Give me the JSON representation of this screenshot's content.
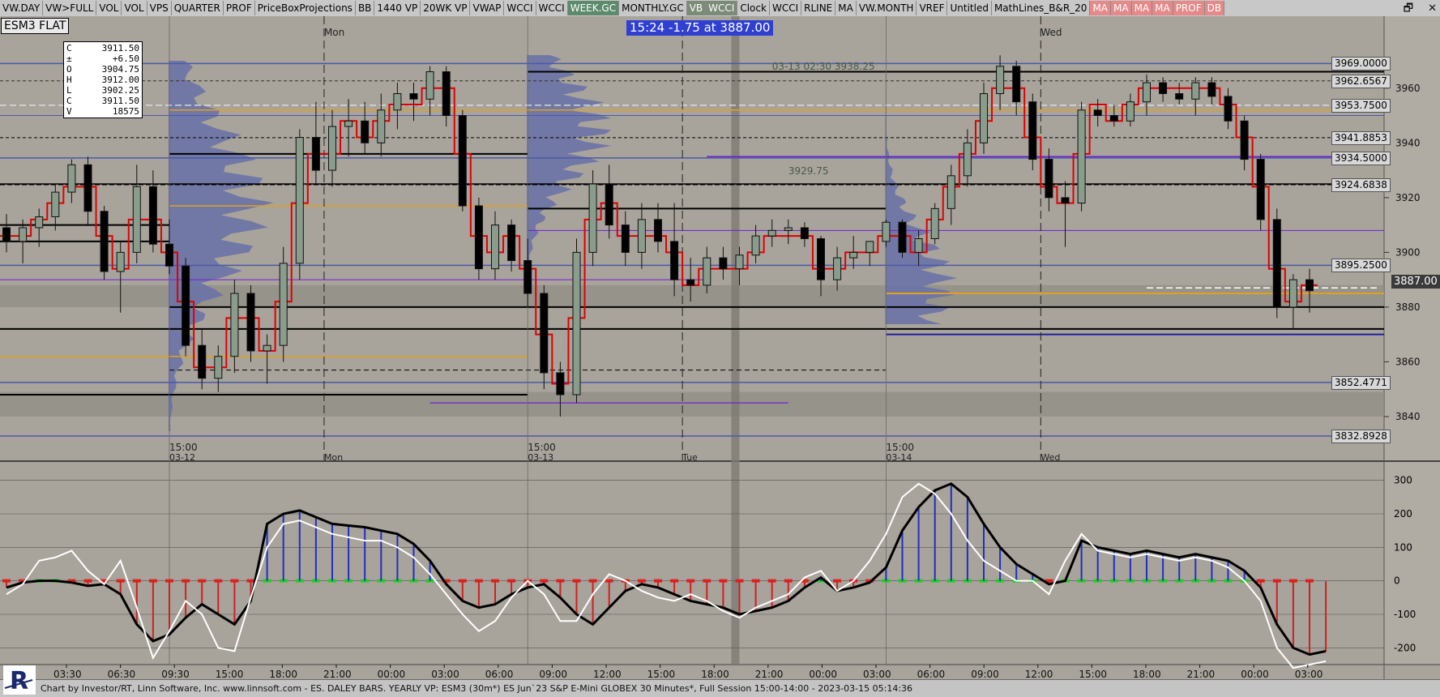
{
  "toolbar": {
    "buttons": [
      {
        "label": "VW.DAY",
        "style": "plain"
      },
      {
        "label": "VW>FULL",
        "style": "plain"
      },
      {
        "label": "VOL",
        "style": "plain"
      },
      {
        "label": "VOL",
        "style": "plain"
      },
      {
        "label": "VPS",
        "style": "plain"
      },
      {
        "label": "QUARTER",
        "style": "plain"
      },
      {
        "label": "PROF",
        "style": "plain"
      },
      {
        "label": "PriceBoxProjections",
        "style": "plain"
      },
      {
        "label": "BB",
        "style": "plain"
      },
      {
        "label": "1440 VP",
        "style": "plain"
      },
      {
        "label": "20WK VP",
        "style": "plain"
      },
      {
        "label": "VWAP",
        "style": "plain"
      },
      {
        "label": "WCCI",
        "style": "plain"
      },
      {
        "label": "WCCI",
        "style": "plain"
      },
      {
        "label": "WEEK.GC",
        "style": "green"
      },
      {
        "label": "MONTHLY.GC",
        "style": "plain"
      },
      {
        "label": "VB",
        "style": "dark"
      },
      {
        "label": "WCCI",
        "style": "dark"
      },
      {
        "label": "Clock",
        "style": "plain"
      },
      {
        "label": "WCCI",
        "style": "plain"
      },
      {
        "label": "RLINE",
        "style": "plain"
      },
      {
        "label": "MA",
        "style": "plain"
      },
      {
        "label": "VW.MONTH",
        "style": "plain"
      },
      {
        "label": "VREF",
        "style": "plain"
      },
      {
        "label": "Untitled",
        "style": "plain"
      },
      {
        "label": "MathLines_B&R_20",
        "style": "plain"
      },
      {
        "label": "MA",
        "style": "red"
      },
      {
        "label": "MA",
        "style": "red"
      },
      {
        "label": "MA",
        "style": "red"
      },
      {
        "label": "MA",
        "style": "red"
      },
      {
        "label": "PROF",
        "style": "red"
      },
      {
        "label": "DB",
        "style": "red"
      }
    ]
  },
  "symbol": "ESM3 FLAT",
  "banner": "15:24  -1.75 at 3887.00",
  "ohlc": [
    {
      "k": "C",
      "v": "3911.50"
    },
    {
      "k": "±",
      "v": "+6.50"
    },
    {
      "k": "O",
      "v": "3904.75"
    },
    {
      "k": "H",
      "v": "3912.00"
    },
    {
      "k": "L",
      "v": "3902.25"
    },
    {
      "k": "C",
      "v": "3911.50"
    },
    {
      "k": "V",
      "v": "18575"
    }
  ],
  "current_price": "3887.00",
  "level_labels": [
    {
      "text": "3969.0000",
      "price": 3969
    },
    {
      "text": "3962.6567",
      "price": 3962.66
    },
    {
      "text": "3953.7500",
      "price": 3953.75
    },
    {
      "text": "3941.8853",
      "price": 3941.89
    },
    {
      "text": "3934.5000",
      "price": 3934.5
    },
    {
      "text": "3924.6838",
      "price": 3924.68
    },
    {
      "text": "3895.2500",
      "price": 3895.25
    },
    {
      "text": "3852.4771",
      "price": 3852.48
    },
    {
      "text": "3832.8928",
      "price": 3832.89
    }
  ],
  "chart_annotations": [
    {
      "text": "3929.75",
      "price": 3929.75,
      "bar": 49
    },
    {
      "text": "03-13 02:30 3938.25",
      "price": 3968,
      "bar": 48
    }
  ],
  "day_labels": [
    {
      "text": "Mon",
      "bar": 19.5
    },
    {
      "text": "Tue",
      "bar": 41.5
    },
    {
      "text": "Wed",
      "bar": 63.5
    }
  ],
  "time_ticks_main": [
    {
      "top": "15:00",
      "bottom": "03-12",
      "bar": 10
    },
    {
      "top": "",
      "bottom": "Mon",
      "bar": 19.5
    },
    {
      "top": "15:00",
      "bottom": "03-13",
      "bar": 32
    },
    {
      "top": "",
      "bottom": "Tue",
      "bar": 41.5
    },
    {
      "top": "15:00",
      "bottom": "03-14",
      "bar": 54
    },
    {
      "top": "",
      "bottom": "Wed",
      "bar": 63.5
    }
  ],
  "time_ticks_bottom": [
    "03:30",
    "06:30",
    "09:30",
    "15:00",
    "18:00",
    "21:00",
    "00:00",
    "03:00",
    "06:00",
    "09:00",
    "12:00",
    "15:00",
    "18:00",
    "21:00",
    "00:00",
    "03:00",
    "06:00",
    "09:00",
    "12:00",
    "15:00",
    "18:00",
    "21:00",
    "00:00",
    "03:00"
  ],
  "footnote": "Chart by Investor/RT, Linn Software, Inc. www.linnsoft.com - ES. DALEY BARS. YEARLY VP: ESM3 (30m*) ES Jun`23 S&P E-Mini GLOBEX 30 Minutes*, Full Session 15:00-14:00 - 2023-03-15 05:14:36",
  "colors": {
    "bg": "#a8a39b",
    "bull": "#8a9c8c",
    "bear": "#000000",
    "vp": "#6b73a6",
    "red_line": "#e00000",
    "orange_line": "#e0a020",
    "purple_line": "#7020d0",
    "blue_line": "#4a5aa8"
  },
  "chart_data": [
    {
      "type": "candlestick",
      "title": "ESM3 FLAT",
      "ylabel": "",
      "ylim": [
        3824,
        3978
      ],
      "y_ticks": [
        3840,
        3860,
        3880,
        3900,
        3920,
        3940,
        3960
      ],
      "ohlc": [
        [
          3909,
          3914,
          3900,
          3904
        ],
        [
          3904,
          3912,
          3896,
          3909
        ],
        [
          3909,
          3916,
          3902,
          3913
        ],
        [
          3913,
          3925,
          3908,
          3922
        ],
        [
          3922,
          3934,
          3918,
          3932
        ],
        [
          3932,
          3935,
          3910,
          3915
        ],
        [
          3915,
          3917,
          3890,
          3893
        ],
        [
          3893,
          3904,
          3878,
          3900
        ],
        [
          3900,
          3932,
          3896,
          3924
        ],
        [
          3924,
          3930,
          3900,
          3903
        ],
        [
          3903,
          3912,
          3892,
          3895
        ],
        [
          3895,
          3898,
          3862,
          3866
        ],
        [
          3866,
          3872,
          3850,
          3854
        ],
        [
          3854,
          3866,
          3849,
          3862
        ],
        [
          3862,
          3890,
          3856,
          3885
        ],
        [
          3885,
          3888,
          3860,
          3864
        ],
        [
          3864,
          3870,
          3852,
          3866
        ],
        [
          3866,
          3902,
          3860,
          3896
        ],
        [
          3896,
          3945,
          3890,
          3942
        ],
        [
          3942,
          3955,
          3925,
          3930
        ],
        [
          3930,
          3952,
          3924,
          3946
        ],
        [
          3946,
          3956,
          3935,
          3948
        ],
        [
          3948,
          3955,
          3936,
          3940
        ],
        [
          3940,
          3958,
          3935,
          3952
        ],
        [
          3952,
          3962,
          3945,
          3958
        ],
        [
          3958,
          3962,
          3948,
          3956
        ],
        [
          3956,
          3968,
          3950,
          3966
        ],
        [
          3966,
          3968,
          3946,
          3950
        ],
        [
          3950,
          3952,
          3915,
          3917
        ],
        [
          3917,
          3920,
          3890,
          3894
        ],
        [
          3894,
          3915,
          3890,
          3910
        ],
        [
          3910,
          3912,
          3893,
          3897
        ],
        [
          3897,
          3905,
          3880,
          3885
        ],
        [
          3885,
          3888,
          3850,
          3856
        ],
        [
          3856,
          3860,
          3840,
          3848
        ],
        [
          3848,
          3905,
          3845,
          3900
        ],
        [
          3900,
          3930,
          3895,
          3925
        ],
        [
          3925,
          3932,
          3905,
          3910
        ],
        [
          3910,
          3915,
          3895,
          3900
        ],
        [
          3900,
          3918,
          3894,
          3912
        ],
        [
          3912,
          3918,
          3900,
          3904
        ],
        [
          3904,
          3918,
          3884,
          3890
        ],
        [
          3890,
          3898,
          3882,
          3888
        ],
        [
          3888,
          3902,
          3885,
          3898
        ],
        [
          3898,
          3902,
          3890,
          3894
        ],
        [
          3894,
          3902,
          3888,
          3899
        ],
        [
          3899,
          3910,
          3896,
          3906
        ],
        [
          3906,
          3912,
          3902,
          3908
        ],
        [
          3908,
          3912,
          3903,
          3909
        ],
        [
          3909,
          3911,
          3902,
          3905
        ],
        [
          3905,
          3906,
          3884,
          3890
        ],
        [
          3890,
          3902,
          3886,
          3898
        ],
        [
          3898,
          3906,
          3894,
          3900
        ],
        [
          3900,
          3904,
          3895,
          3904
        ],
        [
          3904,
          3912,
          3902,
          3911
        ],
        [
          3911,
          3912,
          3898,
          3900
        ],
        [
          3900,
          3908,
          3895,
          3905
        ],
        [
          3905,
          3918,
          3903,
          3916
        ],
        [
          3916,
          3932,
          3910,
          3928
        ],
        [
          3928,
          3945,
          3924,
          3940
        ],
        [
          3940,
          3962,
          3936,
          3958
        ],
        [
          3958,
          3972,
          3952,
          3968
        ],
        [
          3968,
          3970,
          3950,
          3955
        ],
        [
          3955,
          3958,
          3930,
          3934
        ],
        [
          3934,
          3938,
          3915,
          3920
        ],
        [
          3920,
          3926,
          3902,
          3918
        ],
        [
          3918,
          3955,
          3915,
          3952
        ],
        [
          3952,
          3956,
          3946,
          3950
        ],
        [
          3950,
          3954,
          3946,
          3948
        ],
        [
          3948,
          3958,
          3946,
          3955
        ],
        [
          3955,
          3965,
          3950,
          3962
        ],
        [
          3962,
          3964,
          3955,
          3958
        ],
        [
          3958,
          3962,
          3954,
          3956
        ],
        [
          3956,
          3964,
          3950,
          3962
        ],
        [
          3962,
          3964,
          3954,
          3957
        ],
        [
          3957,
          3960,
          3945,
          3948
        ],
        [
          3948,
          3950,
          3930,
          3934
        ],
        [
          3934,
          3936,
          3908,
          3912
        ],
        [
          3912,
          3916,
          3876,
          3880
        ],
        [
          3880,
          3892,
          3872,
          3890
        ],
        [
          3890,
          3894,
          3878,
          3886
        ]
      ]
    },
    {
      "type": "line",
      "title": "",
      "ylim": [
        -250,
        350
      ],
      "y_ticks": [
        -200,
        -100,
        0,
        100,
        200,
        300
      ],
      "series": [
        {
          "values": [
            -20,
            -5,
            0,
            0,
            -5,
            -15,
            -10,
            -40,
            -130,
            -180,
            -160,
            -110,
            -70,
            -100,
            -130,
            -60,
            170,
            200,
            210,
            190,
            170,
            165,
            160,
            150,
            140,
            110,
            60,
            -10,
            -60,
            -80,
            -70,
            -40,
            -20,
            -10,
            -50,
            -100,
            -130,
            -80,
            -30,
            -10,
            -20,
            -40,
            -60,
            -70,
            -80,
            -100,
            -90,
            -80,
            -60,
            -20,
            10,
            -30,
            -20,
            -5,
            40,
            150,
            220,
            270,
            290,
            250,
            170,
            100,
            50,
            20,
            -10,
            0,
            120,
            100,
            90,
            80,
            90,
            80,
            70,
            80,
            70,
            60,
            30,
            -20,
            -130,
            -200,
            -220,
            -210
          ],
          "color": "#000000"
        },
        {
          "values": [
            -40,
            -10,
            60,
            70,
            90,
            30,
            -10,
            60,
            -80,
            -230,
            -150,
            -60,
            -100,
            -200,
            -210,
            -50,
            100,
            170,
            180,
            160,
            140,
            130,
            120,
            120,
            100,
            70,
            20,
            -40,
            -100,
            -150,
            -120,
            -50,
            0,
            -40,
            -120,
            -120,
            -40,
            20,
            0,
            -30,
            -50,
            -60,
            -40,
            -60,
            -90,
            -110,
            -80,
            -60,
            -40,
            10,
            30,
            -30,
            0,
            60,
            140,
            250,
            290,
            260,
            200,
            120,
            60,
            30,
            0,
            0,
            -40,
            60,
            140,
            90,
            80,
            70,
            80,
            70,
            60,
            70,
            60,
            40,
            0,
            -60,
            -200,
            -260,
            -250,
            -240
          ],
          "color": "#ffffff"
        },
        {
          "values": [
            -20,
            -5,
            0,
            0,
            -5,
            -15,
            -10,
            -40,
            -130,
            -180,
            -160,
            -110,
            -70,
            -100,
            -130,
            -60,
            170,
            200,
            210,
            190,
            170,
            165,
            160,
            150,
            140,
            110,
            60,
            -10,
            -60,
            -80,
            -70,
            -40,
            -20,
            -10,
            -50,
            -100,
            -130,
            -80,
            -30,
            -10,
            -20,
            -40,
            -60,
            -70,
            -80,
            -100,
            -90,
            -80,
            -60,
            -20,
            10,
            -30,
            -20,
            -5,
            40,
            150,
            220,
            270,
            290,
            250,
            170,
            100,
            50,
            20,
            -10,
            0,
            120,
            100,
            90,
            80,
            90,
            80,
            70,
            80,
            70,
            60,
            30,
            -20,
            -130,
            -200,
            -220,
            -210
          ],
          "color": "histogram"
        }
      ]
    }
  ]
}
